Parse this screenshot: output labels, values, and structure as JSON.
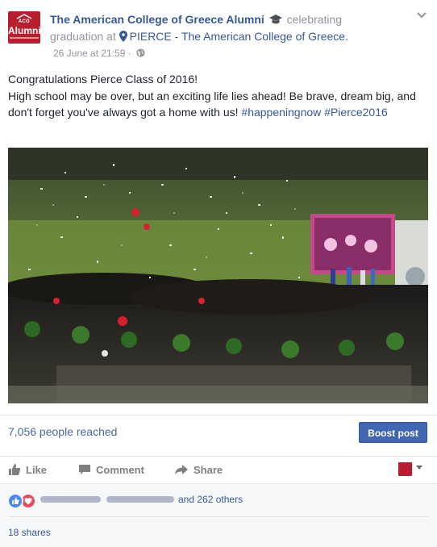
{
  "header": {
    "page_name": "The American College of Greece Alumni",
    "activity": "celebrating graduation at",
    "place": "PIERCE - The American College of Greece.",
    "timestamp": "26 June at 21:59",
    "separator": "·",
    "avatar_small": "ACG",
    "avatar_big": "Alumni"
  },
  "post": {
    "line1": "Congratulations Pierce Class of 2016!",
    "line2_text": "High school may be over, but an exciting life lies ahead! Be brave, dream big, and don't forget you've always got a home with us!",
    "hashtag1": "#happeningnow",
    "hashtag2": "#Pierce2016",
    "photo_alt": "graduation-ceremony-confetti-photo"
  },
  "reach": {
    "text": "7,056 people reached",
    "boost_label": "Boost post"
  },
  "actions": {
    "like": "Like",
    "comment": "Comment",
    "share": "Share"
  },
  "reactions": {
    "others": "and 262 others",
    "shares": "18 shares"
  },
  "colors": {
    "brand_red": "#b8202f",
    "link_blue": "#365899",
    "button_blue": "#4267b2"
  }
}
